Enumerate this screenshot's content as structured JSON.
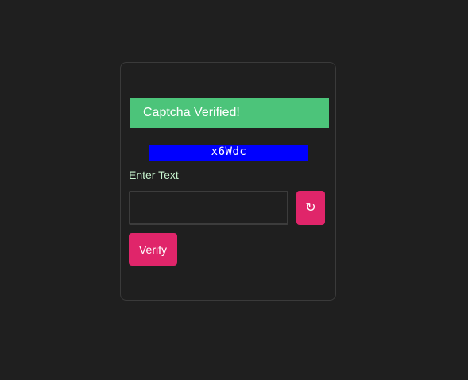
{
  "banner": {
    "message": "Captcha Verified!"
  },
  "captcha": {
    "code": "x6Wdc"
  },
  "form": {
    "label": "Enter Text",
    "input_value": "",
    "input_placeholder": "",
    "refresh_icon": "refresh-icon",
    "refresh_glyph": "↻",
    "verify_label": "Verify"
  },
  "colors": {
    "background": "#1f1f1f",
    "success": "#4cc47a",
    "captcha_bg": "#0000ff",
    "accent": "#e0256a",
    "label": "#c8f5cf"
  }
}
